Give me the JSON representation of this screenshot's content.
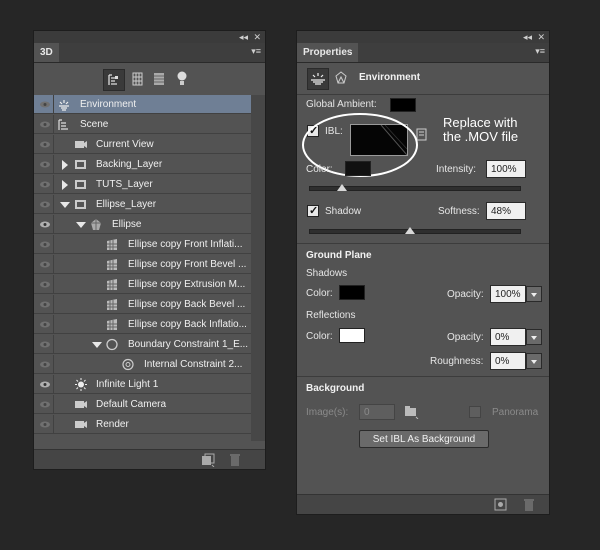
{
  "panel3d": {
    "tab": "3D",
    "layers": [
      {
        "label": "Environment",
        "icon": "environment-icon",
        "selected": true
      },
      {
        "label": "Scene",
        "icon": "scene-icon"
      },
      {
        "label": "Current View",
        "icon": "camera-icon"
      },
      {
        "label": "Backing_Layer",
        "icon": "folder-icon"
      },
      {
        "label": "TUTS_Layer",
        "icon": "folder-icon"
      },
      {
        "label": "Ellipse_Layer",
        "icon": "folder-icon"
      },
      {
        "label": "Ellipse",
        "icon": "mesh-icon"
      },
      {
        "label": "Ellipse copy Front Inflati...",
        "icon": "material-icon"
      },
      {
        "label": "Ellipse copy Front Bevel ...",
        "icon": "material-icon"
      },
      {
        "label": "Ellipse copy Extrusion M...",
        "icon": "material-icon"
      },
      {
        "label": "Ellipse copy Back Bevel ...",
        "icon": "material-icon"
      },
      {
        "label": "Ellipse copy Back Inflatio...",
        "icon": "material-icon"
      },
      {
        "label": "Boundary Constraint 1_E...",
        "icon": "constraint-icon"
      },
      {
        "label": "Internal Constraint 2...",
        "icon": "constraint-icon"
      },
      {
        "label": "Infinite Light 1",
        "icon": "light-icon"
      },
      {
        "label": "Default Camera",
        "icon": "camera-icon"
      },
      {
        "label": "Render",
        "icon": "camera-icon"
      }
    ]
  },
  "properties": {
    "tab": "Properties",
    "title": "Environment",
    "global_ambient_label": "Global Ambient:",
    "ibl_label": "IBL:",
    "callout": "Replace with\nthe .MOV file",
    "color_label": "Color:",
    "intensity_label": "Intensity:",
    "intensity_value": "100%",
    "shadow_label": "Shadow",
    "softness_label": "Softness:",
    "softness_value": "48%",
    "ground_plane_header": "Ground Plane",
    "shadows_label": "Shadows",
    "shadows_color_label": "Color:",
    "shadows_opacity_label": "Opacity:",
    "shadows_opacity_value": "100%",
    "reflections_label": "Reflections",
    "reflections_color_label": "Color:",
    "reflections_opacity_label": "Opacity:",
    "reflections_opacity_value": "0%",
    "roughness_label": "Roughness:",
    "roughness_value": "0%",
    "background_header": "Background",
    "images_label": "Image(s):",
    "images_value": "0",
    "panorama_label": "Panorama",
    "set_ibl_button": "Set IBL As Background"
  },
  "colors": {
    "panel": "#535353",
    "selection": "#6f7f95",
    "shadow_color": "#000000",
    "reflection_color": "#ffffff"
  }
}
